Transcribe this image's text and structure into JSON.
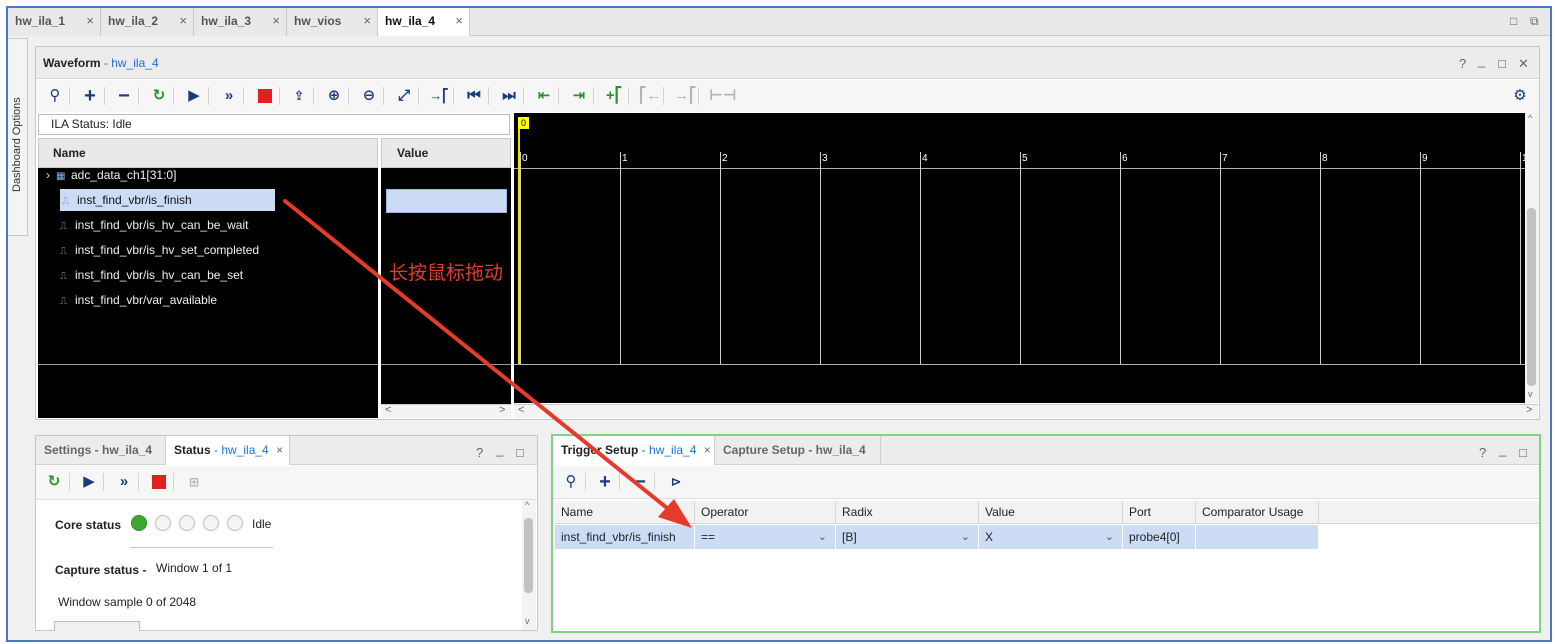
{
  "doc_tabs": [
    {
      "label": "hw_ila_1",
      "close": "×"
    },
    {
      "label": "hw_ila_2",
      "close": "×"
    },
    {
      "label": "hw_ila_3",
      "close": "×"
    },
    {
      "label": "hw_vios",
      "close": "×"
    },
    {
      "label": "hw_ila_4",
      "close": "×"
    }
  ],
  "window_buttons": {
    "restore": "□",
    "maximize": "⧉"
  },
  "dashboard_tab": "Dashboard Options",
  "waveform": {
    "title": "Waveform",
    "title_sep": " - ",
    "subtitle": "hw_ila_4",
    "controls": {
      "help": "?",
      "minimize": "_",
      "restore": "□",
      "close": "✕"
    },
    "ila_status": "ILA Status:  Idle",
    "name_header": "Name",
    "value_header": "Value",
    "signals": [
      {
        "name": "adc_data_ch1[31:0]",
        "expander": "›"
      },
      {
        "name": "inst_find_vbr/is_finish"
      },
      {
        "name": "inst_find_vbr/is_hv_can_be_wait"
      },
      {
        "name": "inst_find_vbr/is_hv_set_completed"
      },
      {
        "name": "inst_find_vbr/is_hv_can_be_set"
      },
      {
        "name": "inst_find_vbr/var_available"
      }
    ],
    "marker_label": "0",
    "ticks": [
      "0",
      "1",
      "2",
      "3",
      "4",
      "5",
      "6",
      "7",
      "8",
      "9",
      "1"
    ],
    "scroll_left": "<",
    "scroll_right": ">",
    "scroll_up": "^",
    "scroll_down": "v"
  },
  "annotation": {
    "text": "长按鼠标拖动",
    "color": "#e63a2a"
  },
  "status_panel": {
    "tabs": [
      {
        "label": "Settings - hw_ila_4"
      },
      {
        "label": "Status",
        "sep": " - ",
        "sub": "hw_ila_4",
        "close": "×"
      }
    ],
    "controls": {
      "help": "?",
      "minimize": "_",
      "restore": "□"
    },
    "core_status_label": "Core status",
    "core_status_value": "Idle",
    "capture_status_label": "Capture status -",
    "capture_status_value": "Window 1 of 1",
    "window_sample": "Window sample 0 of 2048"
  },
  "trigger_panel": {
    "tabs": [
      {
        "label": "Trigger Setup",
        "sep": " - ",
        "sub": "hw_ila_4",
        "close": "×"
      },
      {
        "label": "Capture Setup - hw_ila_4"
      }
    ],
    "controls": {
      "help": "?",
      "minimize": "_",
      "restore": "□"
    },
    "columns": [
      "Name",
      "Operator",
      "Radix",
      "Value",
      "Port",
      "Comparator Usage"
    ],
    "rows": [
      {
        "name": "inst_find_vbr/is_finish",
        "operator": "==",
        "radix": "[B]",
        "value": "X",
        "port": "probe4[0]",
        "usage": ""
      }
    ]
  },
  "colors": {
    "accent": "#1f6fcf",
    "led_green": "#3fa535",
    "stop_red": "#e02020",
    "arrow": "#e63a2a",
    "highlight": "#7ed57e"
  }
}
